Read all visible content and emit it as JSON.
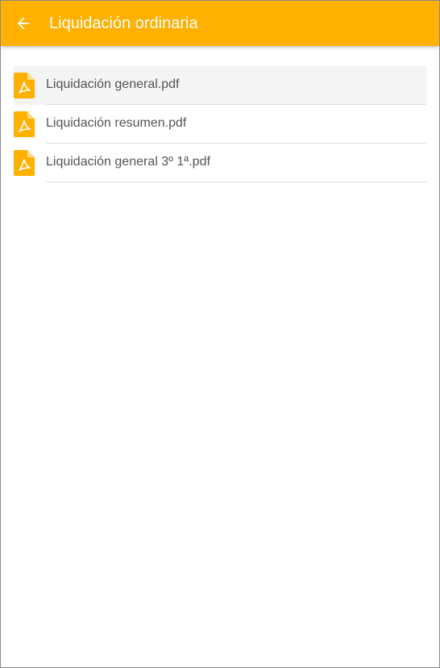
{
  "theme": {
    "accent": "#ffb000",
    "title_color": "#ffffff",
    "text_color": "#555555",
    "divider": "#dcdcdc"
  },
  "header": {
    "back_icon": "arrow-left-icon",
    "title": "Liquidación ordinaria"
  },
  "files": [
    {
      "name": "Liquidación general.pdf",
      "icon": "pdf-file-icon",
      "selected": true
    },
    {
      "name": "Liquidación resumen.pdf",
      "icon": "pdf-file-icon",
      "selected": false
    },
    {
      "name": "Liquidación general 3º 1ª.pdf",
      "icon": "pdf-file-icon",
      "selected": false
    }
  ]
}
